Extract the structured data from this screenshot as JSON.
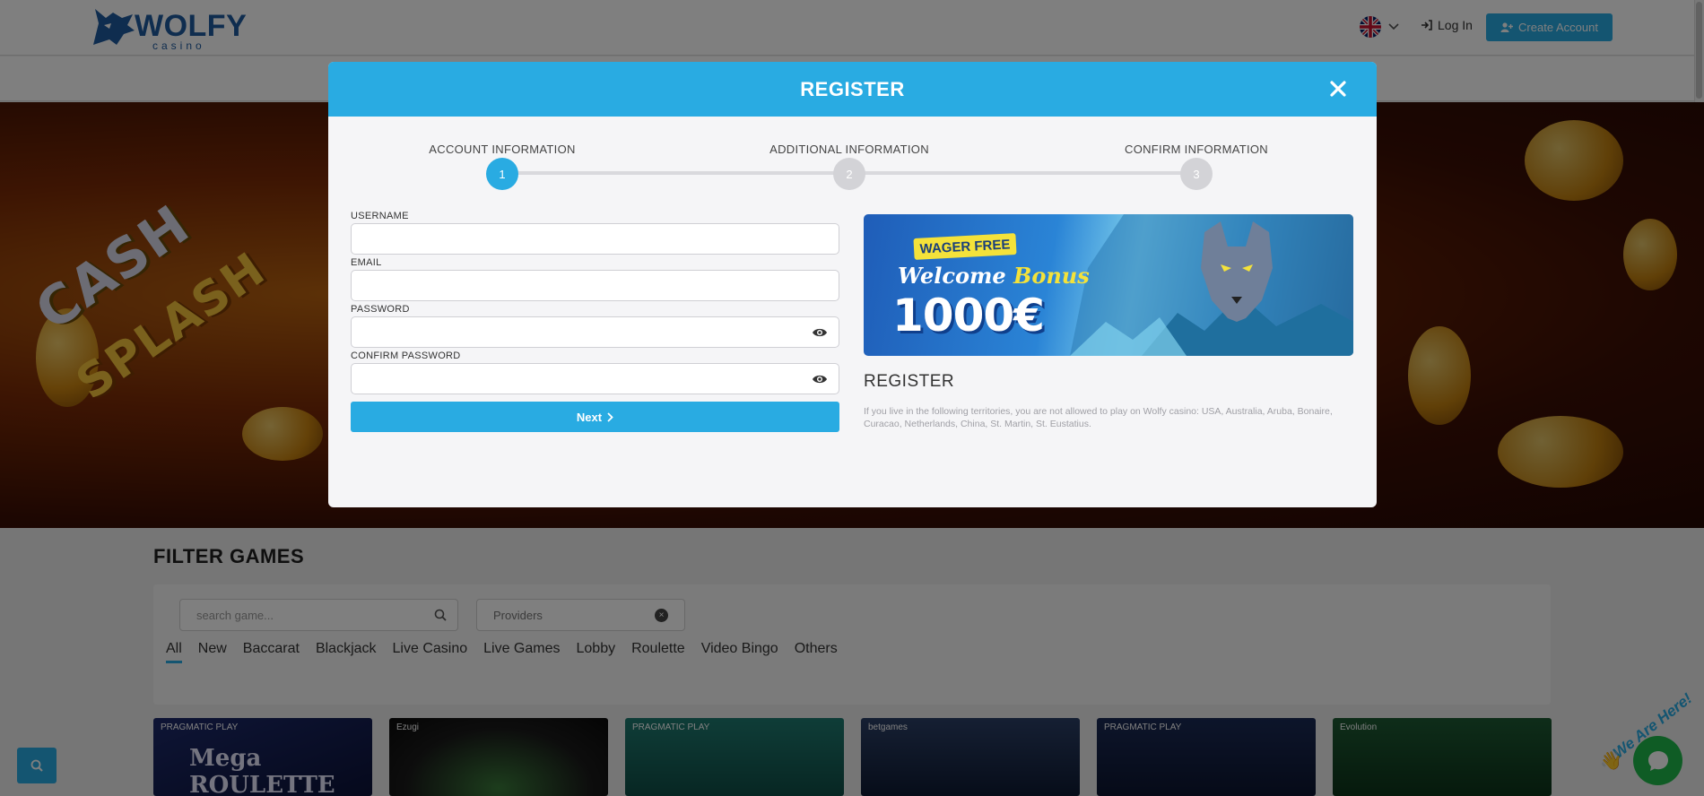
{
  "header": {
    "logo_text": "WOLFY",
    "logo_sub": "casino",
    "login_label": "Log In",
    "create_label": "Create Account"
  },
  "hero": {
    "line1": "CASH",
    "line2": "SPLASH"
  },
  "filter": {
    "title": "FILTER GAMES",
    "search_placeholder": "search game...",
    "providers_label": "Providers",
    "categories": [
      "All",
      "New",
      "Baccarat",
      "Blackjack",
      "Live Casino",
      "Live Games",
      "Lobby",
      "Roulette",
      "Video Bingo",
      "Others"
    ],
    "active_category": "All"
  },
  "tiles": [
    {
      "label": "PRAGMATIC PLAY",
      "title": "Mega ROULETTE"
    },
    {
      "label": "Ezugi",
      "title": ""
    },
    {
      "label": "PRAGMATIC PLAY",
      "title": ""
    },
    {
      "label": "betgames",
      "title": ""
    },
    {
      "label": "PRAGMATIC PLAY",
      "title": ""
    },
    {
      "label": "Evolution",
      "title": ""
    }
  ],
  "modal": {
    "title": "REGISTER",
    "steps": [
      {
        "label": "ACCOUNT INFORMATION",
        "number": "1",
        "active": true
      },
      {
        "label": "ADDITIONAL INFORMATION",
        "number": "2",
        "active": false
      },
      {
        "label": "CONFIRM INFORMATION",
        "number": "3",
        "active": false
      }
    ],
    "fields": {
      "username_label": "USERNAME",
      "email_label": "EMAIL",
      "password_label": "PASSWORD",
      "confirm_label": "CONFIRM PASSWORD"
    },
    "next_label": "Next",
    "banner": {
      "badge": "WAGER FREE",
      "welcome": "Welcome",
      "bonus": "Bonus",
      "amount": "1000€"
    },
    "info_heading": "REGISTER",
    "info_note": "If you live in the following territories, you are not allowed to play on Wolfy casino: USA, Australia, Aruba, Bonaire, Curacao, Netherlands, China, St. Martin, St. Eustatius."
  },
  "chat": {
    "label": "We Are Here!"
  },
  "colors": {
    "accent": "#29abe2",
    "chat_green": "#1fb94a",
    "brand_navy": "#1e5a9e"
  }
}
